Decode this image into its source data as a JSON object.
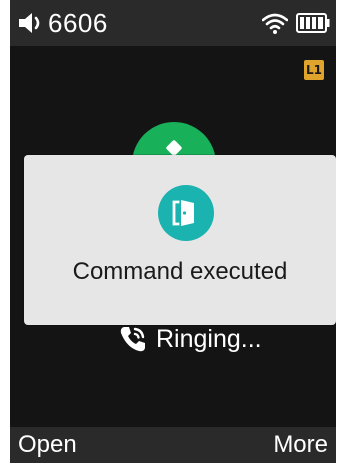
{
  "status_bar": {
    "speaker_icon": "speaker-volume-icon",
    "extension": "6606",
    "wifi_icon": "wifi-icon",
    "battery_icon": "battery-full-icon"
  },
  "call": {
    "line_badge": "L1",
    "ringing_icon": "phone-ringing-icon",
    "status": "Ringing..."
  },
  "popup": {
    "icon": "door-open-icon",
    "message": "Command executed"
  },
  "softkeys": {
    "left": "Open",
    "right": "More"
  },
  "colors": {
    "accent_green": "#19b05a",
    "accent_teal": "#1ab3b0",
    "badge_amber": "#e0a42c",
    "bar_gray": "#2a2a2a",
    "popup_bg": "#e6e6e6"
  }
}
